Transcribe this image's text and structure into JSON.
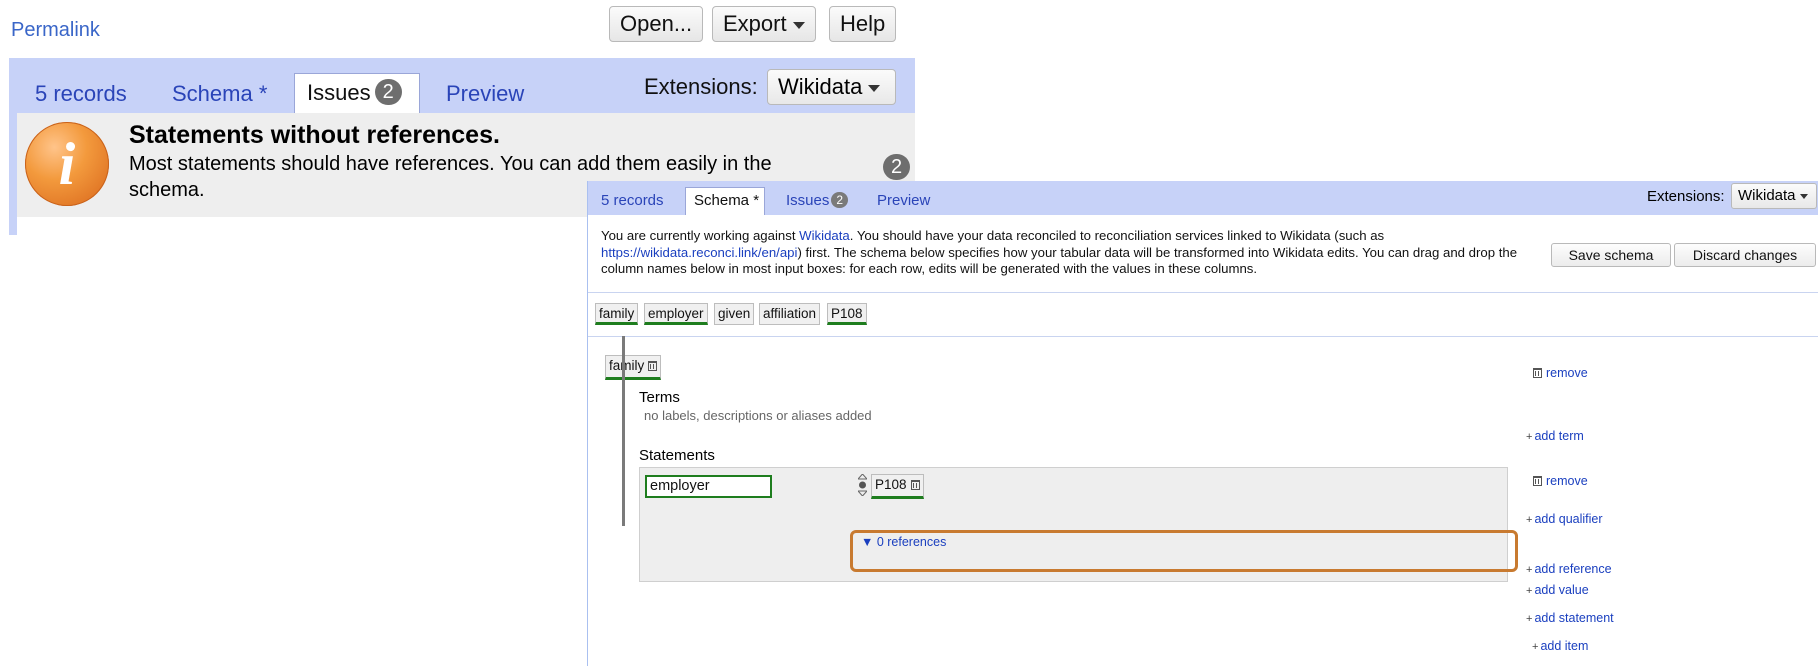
{
  "back": {
    "permalink": "Permalink",
    "buttons": {
      "open": "Open...",
      "export": "Export",
      "help": "Help"
    },
    "tabs": {
      "records": "5 records",
      "schema": "Schema *",
      "issues": "Issues",
      "issues_count": "2",
      "preview": "Preview"
    },
    "extensions_label": "Extensions:",
    "extensions_value": "Wikidata",
    "issue": {
      "icon": "i",
      "title": "Statements without references.",
      "description": "Most statements should have references. You can add them easily in the schema.",
      "count": "2"
    }
  },
  "front": {
    "tabs": {
      "records": "5 records",
      "schema": "Schema *",
      "issues": "Issues",
      "issues_count": "2",
      "preview": "Preview"
    },
    "extensions_label": "Extensions:",
    "extensions_value": "Wikidata",
    "intro": {
      "part1": "You are currently working against ",
      "link1": "Wikidata",
      "part2": ". You should have your data reconciled to reconciliation services linked to Wikidata (such as ",
      "link2": "https://wikidata.reconci.link/en/api",
      "part3": ") first. The schema below specifies how your tabular data will be transformed into Wikidata edits. You can drag and drop the column names below in most input boxes: for each row, edits will be generated with the values in these columns."
    },
    "save_schema": "Save schema",
    "discard_changes": "Discard changes",
    "columns": [
      "family",
      "employer",
      "given",
      "affiliation",
      "P108"
    ],
    "item": {
      "subject": "family",
      "remove": "remove",
      "terms_title": "Terms",
      "terms_empty": "no labels, descriptions or aliases added",
      "add_term": "add term",
      "statements_title": "Statements",
      "statement": {
        "property": "employer",
        "value": "P108",
        "remove": "remove",
        "add_qualifier": "add qualifier",
        "references_toggle": "▼ 0 references",
        "add_reference": "add reference",
        "add_value": "add value"
      },
      "add_statement": "add statement"
    },
    "add_item": "add item"
  },
  "colors": {
    "header_bg": "#c7d2f8",
    "link": "#1a3fbf",
    "used_column": "#1e7d1e",
    "highlight": "#c87a30",
    "info_icon": "#f39a3d"
  }
}
